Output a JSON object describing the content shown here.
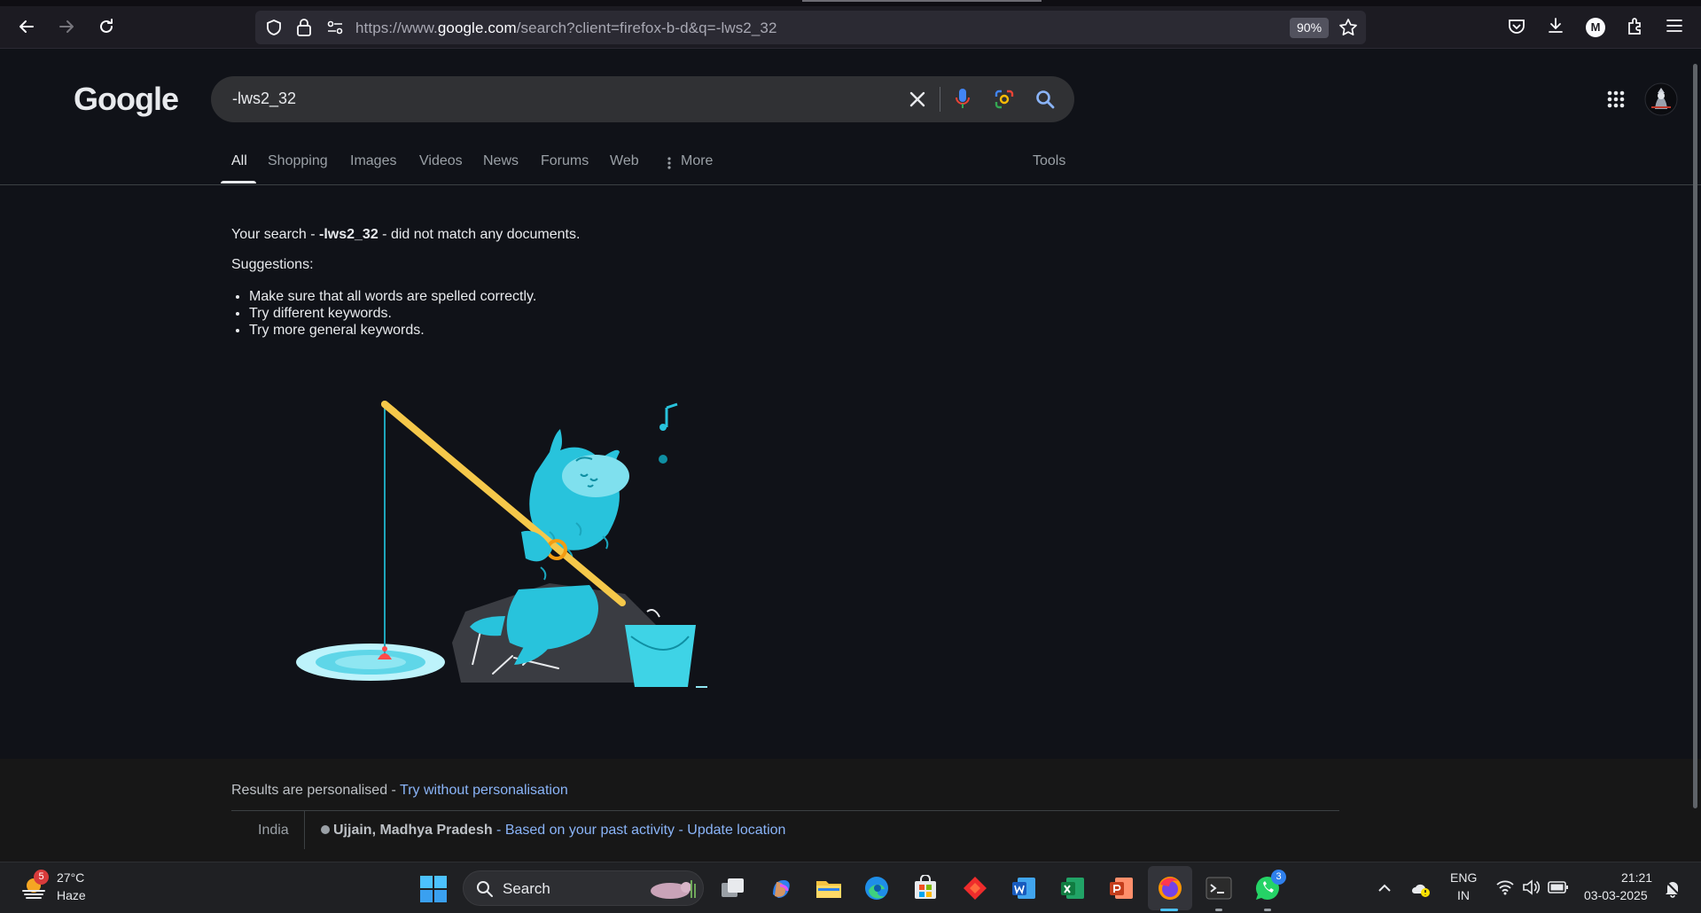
{
  "browser": {
    "url_prefix": "https://www.",
    "url_domain": "google.com",
    "url_rest": "/search?client=firefox-b-d&q=-lws2_32",
    "zoom": "90%",
    "profile_initial": "M"
  },
  "google": {
    "logo": "Google",
    "query": "-lws2_32",
    "tabs": [
      "All",
      "Shopping",
      "Images",
      "Videos",
      "News",
      "Forums",
      "Web",
      "More"
    ],
    "tools": "Tools"
  },
  "results": {
    "nomatch_prefix": "Your search - ",
    "nomatch_query": "-lws2_32",
    "nomatch_suffix": " - did not match any documents.",
    "suggestions_heading": "Suggestions:",
    "suggestions": [
      "Make sure that all words are spelled correctly.",
      "Try different keywords.",
      "Try more general keywords."
    ]
  },
  "footer": {
    "personalised": "Results are personalised - ",
    "try_without": "Try without personalisation",
    "country": "India",
    "location": "Ujjain, Madhya Pradesh",
    "based_on": "Based on your past activity",
    "update_location": "Update location",
    "sep": " - "
  },
  "taskbar": {
    "weather_temp": "27°C",
    "weather_desc": "Haze",
    "weather_badge": "5",
    "search_label": "Search",
    "lang_line1": "ENG",
    "lang_line2": "IN",
    "time": "21:21",
    "date": "03-03-2025",
    "whatsapp_badge": "3"
  },
  "colors": {
    "background": "#101218",
    "link": "#8ab4f8",
    "creature": "#28c3dc",
    "rod": "#f5c84a"
  }
}
